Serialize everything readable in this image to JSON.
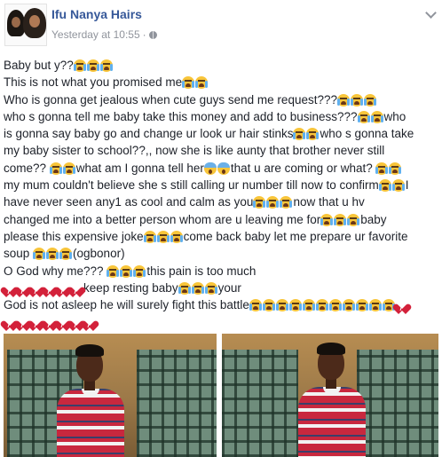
{
  "post": {
    "author": "Ifu Nanya Hairs",
    "timestamp": "Yesterday at 10:55",
    "separator": "·",
    "privacy_icon": "globe-icon",
    "menu_icon": "chevron-down-icon"
  },
  "body_lines": [
    [
      {
        "t": "Baby but y??"
      },
      {
        "e": "cry"
      },
      {
        "e": "cry"
      },
      {
        "e": "cry"
      }
    ],
    [
      {
        "t": "This is not what you promised me"
      },
      {
        "e": "cry"
      },
      {
        "e": "cry"
      }
    ],
    [
      {
        "t": "Who is gonna get jealous when cute guys send me request???"
      },
      {
        "e": "cry"
      },
      {
        "e": "cry"
      },
      {
        "e": "cry"
      }
    ],
    [
      {
        "t": "who s gonna tell me baby take this money and add to business???"
      },
      {
        "e": "cry"
      },
      {
        "e": "cry"
      },
      {
        "t": "who"
      }
    ],
    [
      {
        "t": "is gonna say baby go and change ur look ur hair stinks"
      },
      {
        "e": "cry"
      },
      {
        "e": "cry"
      },
      {
        "t": "who s gonna take"
      }
    ],
    [
      {
        "t": "my baby sister to school??,, now she is like aunty that brother never still"
      }
    ],
    [
      {
        "t": "come?? "
      },
      {
        "e": "cry"
      },
      {
        "e": "cry"
      },
      {
        "t": "what am I gonna tell her"
      },
      {
        "e": "scream"
      },
      {
        "e": "scream"
      },
      {
        "t": "that u are coming or what? "
      },
      {
        "e": "cry"
      },
      {
        "e": "cry"
      }
    ],
    [
      {
        "t": "my mum couldn't believe she s still calling ur number till now to confirm"
      },
      {
        "e": "cry"
      },
      {
        "e": "cry"
      },
      {
        "t": "I"
      }
    ],
    [
      {
        "t": "have never seen any1 as cool and calm as you"
      },
      {
        "e": "cry"
      },
      {
        "e": "cry"
      },
      {
        "e": "cry"
      },
      {
        "t": "now that u hv"
      }
    ],
    [
      {
        "t": "changed me into a better person whom are u leaving me for"
      },
      {
        "e": "cry"
      },
      {
        "e": "cry"
      },
      {
        "e": "cry"
      },
      {
        "t": "baby"
      }
    ],
    [
      {
        "t": "please this expensive joke"
      },
      {
        "e": "cry"
      },
      {
        "e": "cry"
      },
      {
        "e": "cry"
      },
      {
        "t": "come back baby let me prepare ur favorite"
      }
    ],
    [
      {
        "t": "soup "
      },
      {
        "e": "cry"
      },
      {
        "e": "cry"
      },
      {
        "e": "cry"
      },
      {
        "t": "(ogbonor)"
      }
    ],
    [
      {
        "t": "O God why me??? "
      },
      {
        "e": "cry"
      },
      {
        "e": "cry"
      },
      {
        "e": "cry"
      },
      {
        "t": "this pain is too much"
      }
    ],
    [
      {
        "e": "heart"
      },
      {
        "e": "heart"
      },
      {
        "e": "heart"
      },
      {
        "e": "heart"
      },
      {
        "e": "heart"
      },
      {
        "e": "heart"
      },
      {
        "t": "keep resting baby"
      },
      {
        "e": "cry"
      },
      {
        "e": "cry"
      },
      {
        "e": "cry"
      },
      {
        "t": "your"
      }
    ],
    [
      {
        "t": "God is not asleep he will surely fight this battle"
      },
      {
        "e": "cry"
      },
      {
        "e": "cry"
      },
      {
        "e": "cry"
      },
      {
        "e": "cry"
      },
      {
        "e": "cry"
      },
      {
        "e": "cry"
      },
      {
        "e": "cry"
      },
      {
        "e": "cry"
      },
      {
        "e": "cry"
      },
      {
        "e": "cry"
      },
      {
        "e": "cry"
      },
      {
        "e": "heart"
      }
    ],
    [
      {
        "e": "heart"
      },
      {
        "e": "heart"
      },
      {
        "e": "heart"
      },
      {
        "e": "heart"
      },
      {
        "e": "heart"
      },
      {
        "e": "heart"
      },
      {
        "e": "heart"
      }
    ]
  ],
  "photos": [
    {
      "name": "photo-left",
      "description_icon": "person-photo"
    },
    {
      "name": "photo-right",
      "description_icon": "person-photo"
    }
  ]
}
